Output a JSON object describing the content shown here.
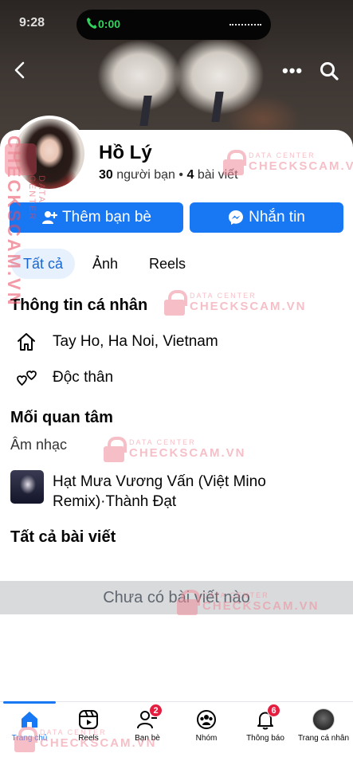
{
  "status": {
    "time": "9:28",
    "call_time": "0:00"
  },
  "profile": {
    "name": "Hồ Lý",
    "friends_count": "30",
    "friends_label": "người bạn",
    "posts_count": "4",
    "posts_label": "bài viết",
    "separator": "•"
  },
  "actions": {
    "add_friend": "Thêm bạn bè",
    "message": "Nhắn tin"
  },
  "tabs": [
    {
      "label": "Tất cả"
    },
    {
      "label": "Ảnh"
    },
    {
      "label": "Reels"
    }
  ],
  "about": {
    "heading": "Thông tin cá nhân",
    "location": "Tay Ho, Ha Noi, Vietnam",
    "relationship": "Độc thân"
  },
  "interests": {
    "heading": "Mối quan tâm",
    "category": "Âm nhạc",
    "track": "Hạt Mưa Vương Vấn (Việt Mino Remix)·Thành Đạt"
  },
  "posts": {
    "heading": "Tất cả bài viết",
    "empty": "Chưa có bài viết nào"
  },
  "bottom_nav": [
    {
      "label": "Trang chủ",
      "icon": "home-icon"
    },
    {
      "label": "Reels",
      "icon": "reels-icon"
    },
    {
      "label": "Bạn bè",
      "icon": "friends-icon",
      "badge": "2"
    },
    {
      "label": "Nhóm",
      "icon": "groups-icon"
    },
    {
      "label": "Thông báo",
      "icon": "bell-icon",
      "badge": "6"
    },
    {
      "label": "Trang cá nhân",
      "icon": "profile-avatar"
    }
  ],
  "watermark": {
    "line1": "DATA CENTER",
    "line2": "CHECKSCAM.VN"
  },
  "colors": {
    "accent": "#1877f2",
    "badge": "#e41e3f",
    "watermark": "#f08c9a"
  }
}
